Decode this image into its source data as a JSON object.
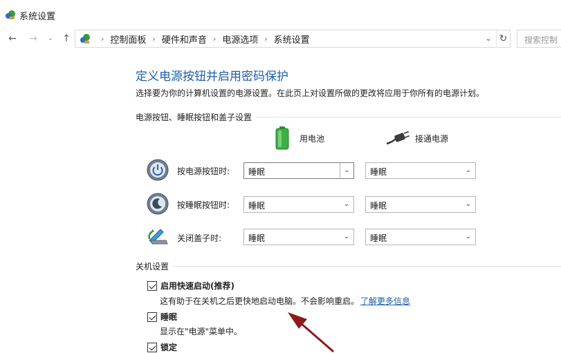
{
  "window": {
    "title": "系统设置"
  },
  "nav": {
    "back_glyph": "←",
    "forward_glyph": "→",
    "recent_glyph": "⌄",
    "up_glyph": "↑"
  },
  "address": {
    "breadcrumbs": [
      "控制面板",
      "硬件和声音",
      "电源选项",
      "系统设置"
    ],
    "separator": "›",
    "dropdown_glyph": "⌄",
    "refresh_glyph": "↻"
  },
  "search": {
    "placeholder": "搜索控制"
  },
  "main": {
    "title": "定义电源按钮并启用密码保护",
    "description": "选择要为你的计算机设置的电源设置。在此页上对设置所做的更改将应用于你所有的电源计划。"
  },
  "power_buttons": {
    "heading": "电源按钮、睡眠按钮和盖子设置",
    "col_battery": "用电池",
    "col_plugged": "接通电源",
    "rows": [
      {
        "label": "按电源按钮时:",
        "battery": "睡眠",
        "plugged": "睡眠"
      },
      {
        "label": "按睡眠按钮时:",
        "battery": "睡眠",
        "plugged": "睡眠"
      },
      {
        "label": "关闭盖子时:",
        "battery": "睡眠",
        "plugged": "睡眠"
      }
    ],
    "select_arrow": "⌄"
  },
  "shutdown": {
    "heading": "关机设置",
    "fast_startup": {
      "label": "启用快速启动(推荐)",
      "checked": true,
      "desc": "这有助于在关机之后更快地启动电脑。不会影响重启。",
      "link": "了解更多信息"
    },
    "sleep": {
      "label": "睡眠",
      "checked": true,
      "desc": "显示在\"电源\"菜单中。"
    },
    "lock": {
      "label": "锁定",
      "checked": true
    }
  },
  "colors": {
    "title_blue": "#1c5fa8",
    "annotation_arrow": "#8b1a1a"
  }
}
